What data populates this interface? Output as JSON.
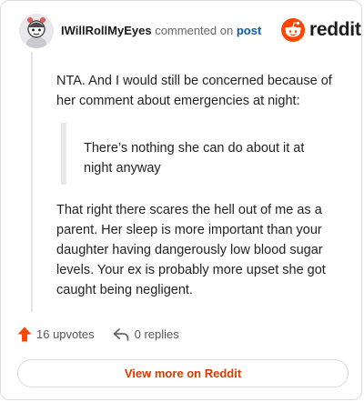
{
  "header": {
    "username": "IWillRollMyEyes",
    "commented_on": "commented on",
    "post_link": "post",
    "brand": "reddit"
  },
  "comment": {
    "paragraph1": "NTA. And I would still be concerned because of her comment about emergencies at night:",
    "quote": "There’s nothing she can do about it at night anyway",
    "paragraph2": "That right there scares the hell out of me as a parent. Her sleep is more important than your daughter having dangerously low blood sugar levels. Your ex is probably more upset she got caught being negligent."
  },
  "actions": {
    "upvotes": "16 upvotes",
    "replies": "0 replies"
  },
  "footer": {
    "view_more": "View more on Reddit"
  },
  "colors": {
    "brand_orange": "#ff4500",
    "link_blue": "#0a5ea8",
    "button_text": "#d93a00"
  },
  "icons": [
    "avatar",
    "reddit-logo-icon",
    "upvote-arrow-icon",
    "reply-icon"
  ]
}
